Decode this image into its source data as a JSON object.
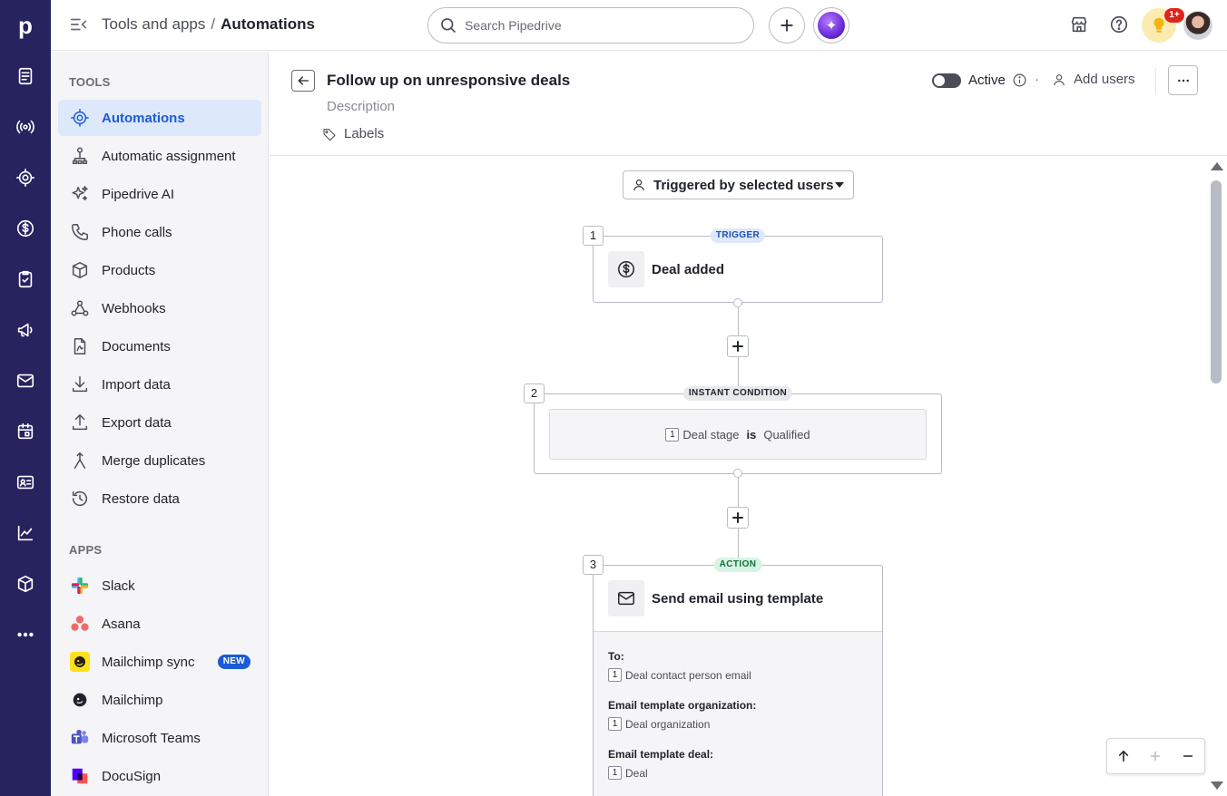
{
  "app": {
    "logo_letter": "p"
  },
  "rail": {
    "items": [
      "leads-icon",
      "radio-signal-icon",
      "target-icon",
      "dollar-icon",
      "tasks-icon",
      "megaphone-icon",
      "mail-icon",
      "calendar-icon",
      "contacts-icon",
      "chart-icon",
      "box-icon",
      "more-icon"
    ]
  },
  "topbar": {
    "breadcrumb_parent": "Tools and apps",
    "breadcrumb_separator": "/",
    "breadcrumb_current": "Automations",
    "search_placeholder": "Search Pipedrive",
    "notification_count": "1+"
  },
  "sidebar": {
    "tools_heading": "TOOLS",
    "tools": [
      {
        "label": "Automations",
        "icon": "automation-icon",
        "active": true
      },
      {
        "label": "Automatic assignment",
        "icon": "assignment-icon"
      },
      {
        "label": "Pipedrive AI",
        "icon": "sparkles-icon"
      },
      {
        "label": "Phone calls",
        "icon": "phone-icon"
      },
      {
        "label": "Products",
        "icon": "box-icon"
      },
      {
        "label": "Webhooks",
        "icon": "webhook-icon"
      },
      {
        "label": "Documents",
        "icon": "document-icon"
      },
      {
        "label": "Import data",
        "icon": "download-icon"
      },
      {
        "label": "Export data",
        "icon": "upload-icon"
      },
      {
        "label": "Merge duplicates",
        "icon": "merge-icon"
      },
      {
        "label": "Restore data",
        "icon": "restore-icon"
      }
    ],
    "apps_heading": "APPS",
    "apps": [
      {
        "label": "Slack",
        "icon": "slack-logo"
      },
      {
        "label": "Asana",
        "icon": "asana-logo"
      },
      {
        "label": "Mailchimp sync",
        "icon": "mailchimp-logo",
        "badge": "NEW"
      },
      {
        "label": "Mailchimp",
        "icon": "mailchimp-mono-logo"
      },
      {
        "label": "Microsoft Teams",
        "icon": "teams-logo"
      },
      {
        "label": "DocuSign",
        "icon": "docusign-logo"
      }
    ]
  },
  "automation": {
    "title": "Follow up on unresponsive deals",
    "description_placeholder": "Description",
    "labels_label": "Labels",
    "status_label": "Active",
    "status_on": false,
    "separator": "·",
    "add_users_label": "Add users"
  },
  "canvas": {
    "trigger_selector": "Triggered by selected users",
    "steps": [
      {
        "number": "1",
        "tag": "TRIGGER",
        "title": "Deal added",
        "icon": "dollar-icon"
      },
      {
        "number": "2",
        "tag": "INSTANT CONDITION",
        "condition": {
          "ref": "1",
          "field": "Deal stage",
          "operator": "is",
          "value": "Qualified"
        }
      },
      {
        "number": "3",
        "tag": "ACTION",
        "title": "Send email using template",
        "icon": "mail-icon",
        "fields": [
          {
            "label": "To:",
            "ref": "1",
            "value": "Deal contact person email"
          },
          {
            "label": "Email template organization:",
            "ref": "1",
            "value": "Deal organization"
          },
          {
            "label": "Email template deal:",
            "ref": "1",
            "value": "Deal"
          }
        ]
      }
    ]
  },
  "colors": {
    "rail_bg": "#26235f",
    "accent": "#1c5bd6",
    "active_item_bg": "#dde8fb"
  }
}
